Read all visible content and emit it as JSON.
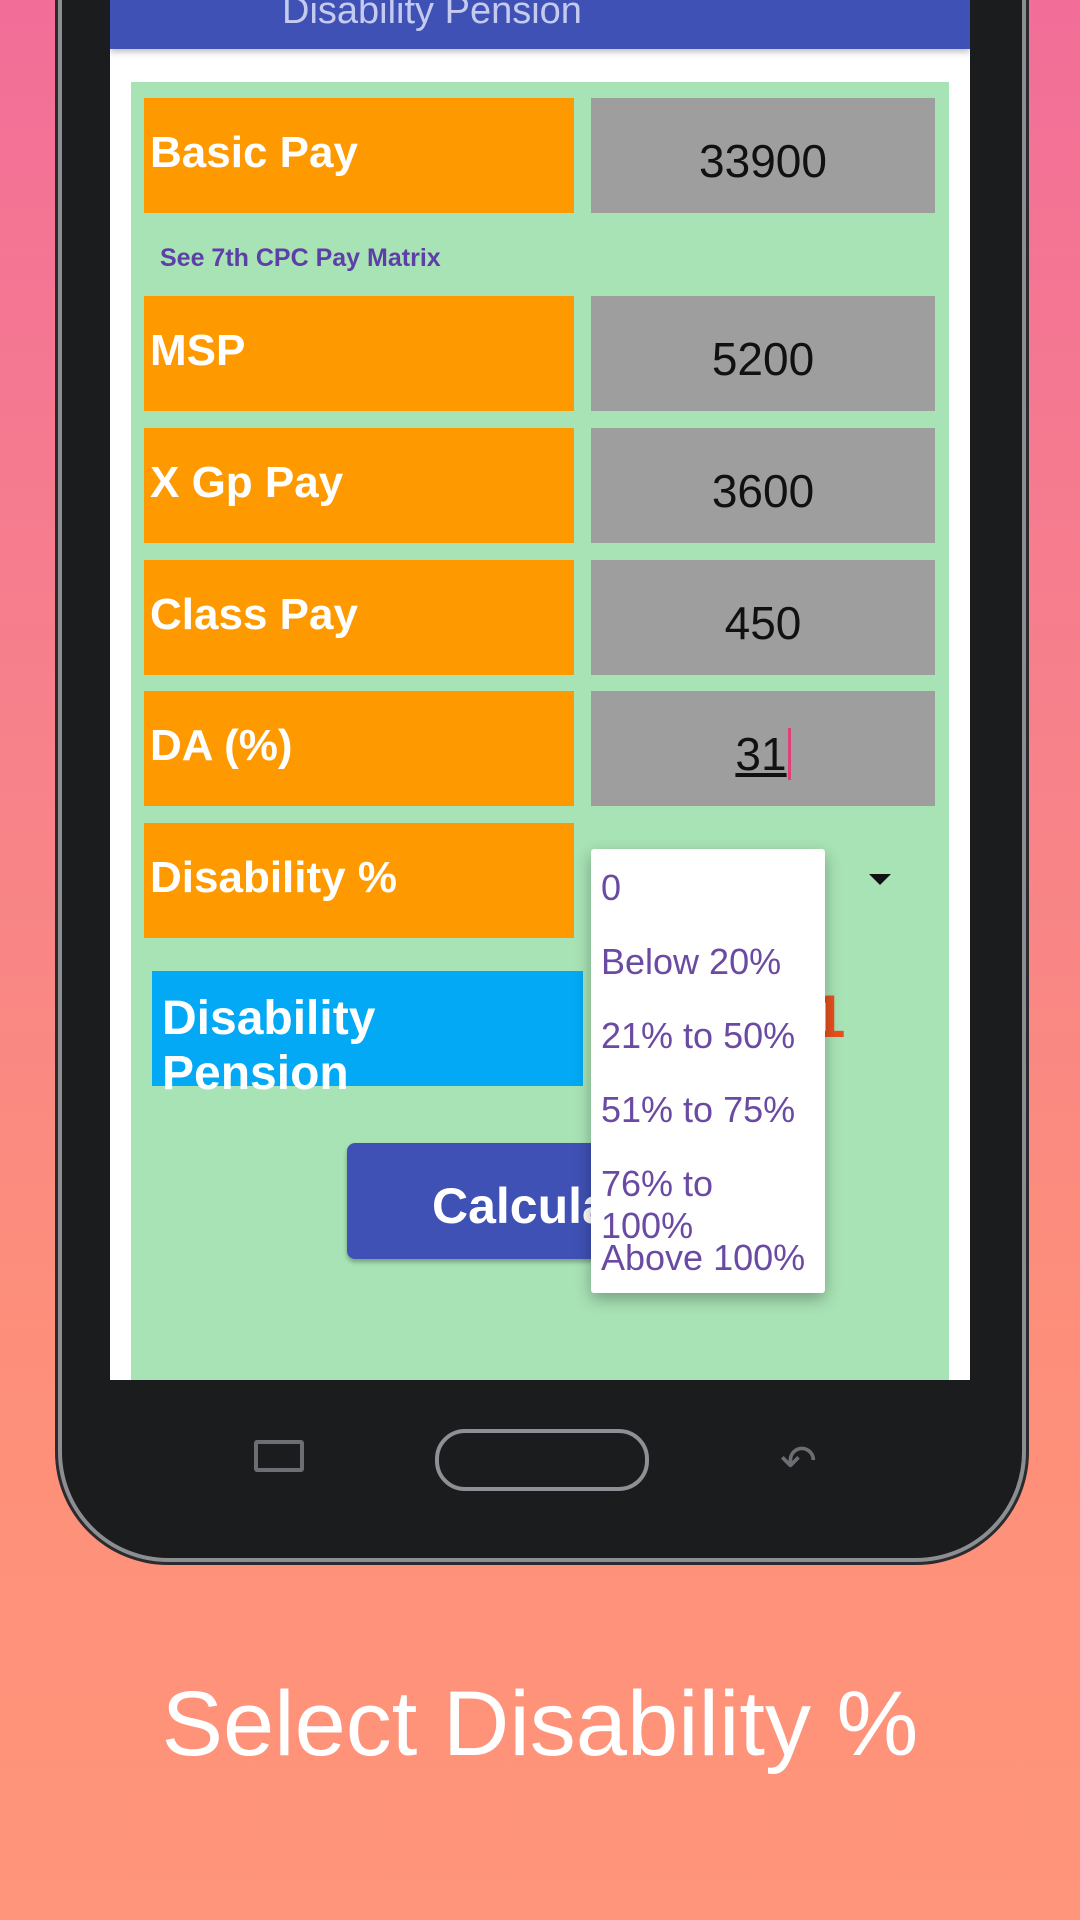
{
  "app_title": "Disability Pension",
  "fields": [
    {
      "label": "Basic Pay",
      "value": "33900"
    },
    {
      "label": "MSP",
      "value": "5200"
    },
    {
      "label": "X Gp Pay",
      "value": "3600"
    },
    {
      "label": "Class Pay",
      "value": "450"
    },
    {
      "label": "DA (%)",
      "value": "31"
    }
  ],
  "pay_matrix_link": "See 7th CPC Pay Matrix",
  "disability_label": "Disability %",
  "dropdown_options": [
    "0",
    "Below 20%",
    "21% to 50%",
    "51% to 75%",
    "76% to 100%",
    "Above 100%"
  ],
  "pension_label": "Disability Pension",
  "pension_value_partial": "1",
  "calculate_label": "Calcula",
  "caption": "Select Disability %",
  "colors": {
    "label_bg": "#fe9900",
    "value_bg": "#9e9e9e",
    "panel_bg": "#a8e3b5",
    "appbar": "#3f51b5",
    "pension_bg": "#03a9f4"
  }
}
